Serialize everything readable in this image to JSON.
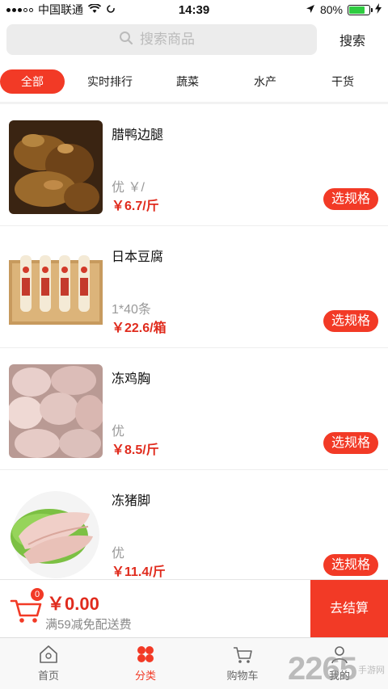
{
  "status_bar": {
    "carrier": "中国联通",
    "time": "14:39",
    "battery": "80%",
    "battery_level": 0.8
  },
  "search": {
    "placeholder": "搜索商品",
    "button_label": "搜索"
  },
  "tabs": [
    {
      "label": "全部",
      "active": true
    },
    {
      "label": "实时排行",
      "active": false
    },
    {
      "label": "蔬菜",
      "active": false
    },
    {
      "label": "水产",
      "active": false
    },
    {
      "label": "干货",
      "active": false
    }
  ],
  "products": [
    {
      "name": "腊鸭边腿",
      "spec": "优 ￥/",
      "price": "￥6.7/斤",
      "button": "选规格",
      "image": "cured-duck-image"
    },
    {
      "name": "日本豆腐",
      "spec": "1*40条",
      "price": "￥22.6/箱",
      "button": "选规格",
      "image": "tofu-image"
    },
    {
      "name": "冻鸡胸",
      "spec": "优",
      "price": "￥8.5/斤",
      "button": "选规格",
      "image": "chicken-breast-image"
    },
    {
      "name": "冻猪脚",
      "spec": "优",
      "price": "￥11.4/斤",
      "button": "选规格",
      "image": "pork-trotter-image"
    }
  ],
  "cart": {
    "count": "0",
    "total": "￥0.00",
    "note": "满59减免配送费",
    "checkout_label": "去结算"
  },
  "tabbar": [
    {
      "label": "首页",
      "icon": "home-icon",
      "active": false
    },
    {
      "label": "分类",
      "icon": "category-icon",
      "active": true
    },
    {
      "label": "购物车",
      "icon": "cart-icon",
      "active": false
    },
    {
      "label": "我的",
      "icon": "profile-icon",
      "active": false
    }
  ],
  "watermark": {
    "number": "2265",
    "site": "手游网"
  },
  "colors": {
    "accent": "#f23a26",
    "price": "#e02b1d",
    "battery": "#2ecc40"
  }
}
